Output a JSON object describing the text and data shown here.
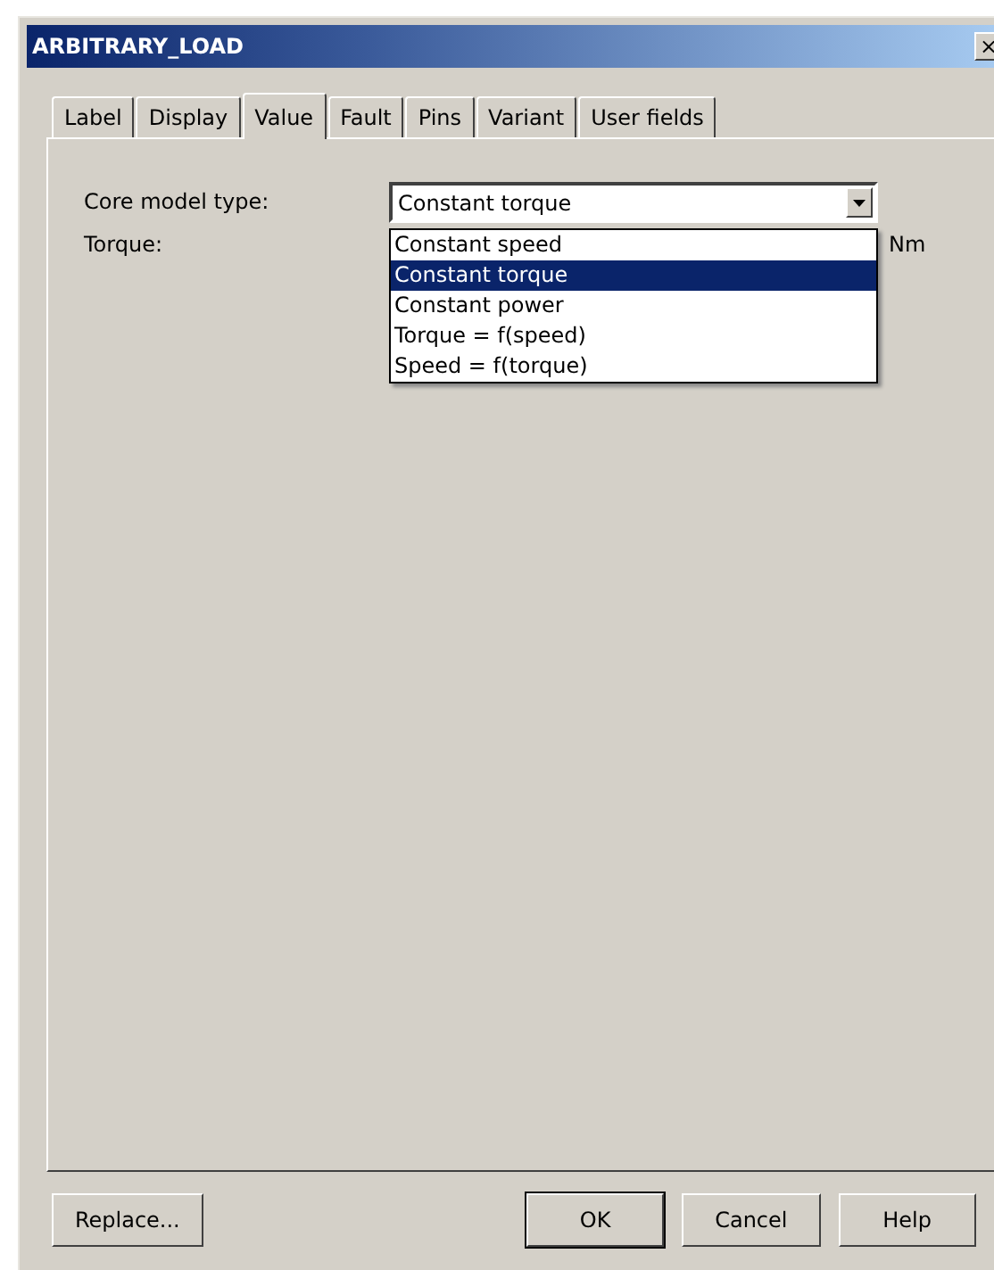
{
  "window": {
    "title": "ARBITRARY_LOAD",
    "close": "×"
  },
  "tabs": [
    {
      "label": "Label",
      "selected": false
    },
    {
      "label": "Display",
      "selected": false
    },
    {
      "label": "Value",
      "selected": true
    },
    {
      "label": "Fault",
      "selected": false
    },
    {
      "label": "Pins",
      "selected": false
    },
    {
      "label": "Variant",
      "selected": false
    },
    {
      "label": "User fields",
      "selected": false
    }
  ],
  "fields": [
    {
      "label": "Core model type:",
      "value": "Constant torque",
      "expanded": true,
      "options": [
        {
          "label": "Constant speed",
          "selected": false
        },
        {
          "label": "Constant torque",
          "selected": true
        },
        {
          "label": "Constant power",
          "selected": false
        },
        {
          "label": "Torque = f(speed)",
          "selected": false
        },
        {
          "label": "Speed = f(torque)",
          "selected": false
        }
      ]
    },
    {
      "label": "Torque:",
      "unit": "Nm"
    }
  ],
  "buttons": [
    {
      "label": "Replace...",
      "default": false
    },
    {
      "label": "OK",
      "default": true
    },
    {
      "label": "Cancel",
      "default": false
    },
    {
      "label": "Help",
      "default": false
    }
  ]
}
